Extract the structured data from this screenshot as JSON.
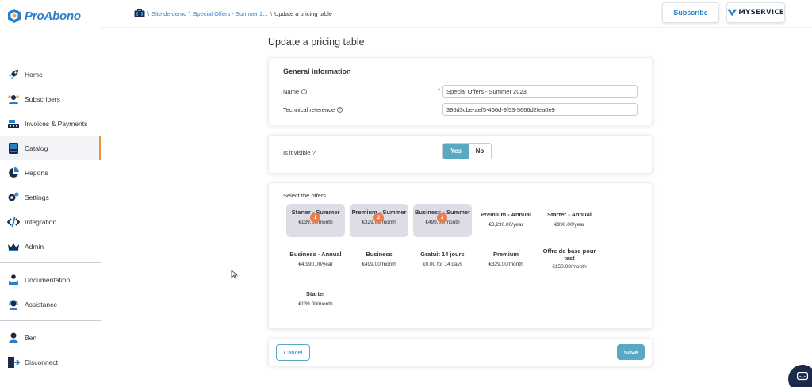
{
  "brand": {
    "logo_text": "ProAbono",
    "accent": "#2a7fc9",
    "active_color": "#e8923a",
    "toggle_color": "#5aa9c4",
    "badge_color": "#ee7b4a"
  },
  "sidebar": {
    "items": [
      {
        "label": "Home",
        "icon": "rocket-icon"
      },
      {
        "label": "Subscribers",
        "icon": "subscribers-icon"
      },
      {
        "label": "Invoices & Payments",
        "icon": "cash-register-icon"
      },
      {
        "label": "Catalog",
        "icon": "catalog-icon",
        "active": true
      },
      {
        "label": "Reports",
        "icon": "pie-chart-icon"
      },
      {
        "label": "Settings",
        "icon": "gear-icon"
      },
      {
        "label": "Integration",
        "icon": "code-icon"
      },
      {
        "label": "Admin",
        "icon": "crown-icon"
      }
    ],
    "help_items": [
      {
        "label": "Documentation",
        "icon": "reader-icon"
      },
      {
        "label": "Assistance",
        "icon": "headset-icon"
      }
    ],
    "user_items": [
      {
        "label": "Ben",
        "icon": "user-icon"
      },
      {
        "label": "Disconnect",
        "icon": "logout-icon"
      }
    ]
  },
  "breadcrumb": {
    "items": [
      "Site de demo",
      "Special Offers - Summer 2...",
      "Update a pricing table"
    ],
    "separator": "\\"
  },
  "header": {
    "subscribe_label": "Subscribe",
    "service_name": "MYSERVICE"
  },
  "page": {
    "title": "Update a pricing table"
  },
  "general": {
    "title": "General information",
    "name_label": "Name",
    "name_required": "*",
    "name_value": "Special Offers - Summer 2023",
    "techref_label": "Technical reference",
    "techref_value": "396d3cbe-aef5-466d-9f53-5666d2fea0e9",
    "help_glyph": "?"
  },
  "visibility": {
    "label": "Is it visible ?",
    "yes_label": "Yes",
    "no_label": "No",
    "selected": "Yes"
  },
  "offers": {
    "label": "Select the offers",
    "items": [
      {
        "name": "Starter - Summer",
        "price": "€139.00/month",
        "selected": true,
        "order": "1"
      },
      {
        "name": "Premium - Summer",
        "price": "€329.00/month",
        "selected": true,
        "order": "2"
      },
      {
        "name": "Business - Summer",
        "price": "€499.00/month",
        "selected": true,
        "order": "3"
      },
      {
        "name": "Premium - Annual",
        "price": "€3,290.00/year",
        "selected": false
      },
      {
        "name": "Starter - Annual",
        "price": "€990.00/year",
        "selected": false
      },
      {
        "name": "Business - Annual",
        "price": "€4,990.00/year",
        "selected": false
      },
      {
        "name": "Business",
        "price": "€499.00/month",
        "selected": false
      },
      {
        "name": "Gratuit 14 jours",
        "price": "€0.00 for 14 days",
        "selected": false
      },
      {
        "name": "Premium",
        "price": "€329.00/month",
        "selected": false
      },
      {
        "name": "Offre de base pour test",
        "price": "€150.00/month",
        "selected": false
      },
      {
        "name": "Starter",
        "price": "€139.00/month",
        "selected": false
      }
    ]
  },
  "actions": {
    "cancel_label": "Cancel",
    "save_label": "Save"
  }
}
